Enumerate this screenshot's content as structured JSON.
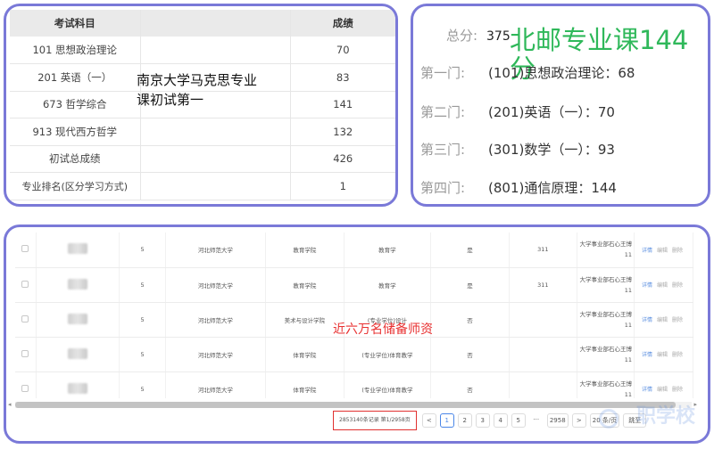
{
  "scores": {
    "header": {
      "subject": "考试科目",
      "score": "成绩"
    },
    "rows": [
      {
        "subject": "101 思想政治理论",
        "score": "70"
      },
      {
        "subject": "201 英语（一）",
        "score": "83"
      },
      {
        "subject": "673 哲学综合",
        "score": "141"
      },
      {
        "subject": "913 现代西方哲学",
        "score": "132"
      },
      {
        "subject": "初试总成绩",
        "score": "426"
      },
      {
        "subject": "专业排名(区分学习方式)",
        "score": "1"
      }
    ],
    "overlay_line1": "南京大学马克思专业",
    "overlay_line2": "课初试第一"
  },
  "bupt": {
    "total_label": "总分:",
    "total_value": "375",
    "headline_line1": "北邮专业课144",
    "headline_line2": "分",
    "items": [
      {
        "label": "第一门:",
        "value": "(101)思想政治理论：68"
      },
      {
        "label": "第二门:",
        "value": "(201)英语（一）：70"
      },
      {
        "label": "第三门:",
        "value": "(301)数学（一）：93"
      },
      {
        "label": "第四门:",
        "value": "(801)通信原理：144"
      }
    ]
  },
  "grid": {
    "rows": [
      {
        "num": "5",
        "school": "河北师范大学",
        "college": "教育学院",
        "major": "教育学",
        "flag": "是",
        "code": "311",
        "employer": "大学事业部石心王博11"
      },
      {
        "num": "5",
        "school": "河北师范大学",
        "college": "教育学院",
        "major": "教育学",
        "flag": "是",
        "code": "311",
        "employer": "大学事业部石心王博11"
      },
      {
        "num": "5",
        "school": "河北师范大学",
        "college": "美术与设计学院",
        "major": "(专业学位)设计",
        "flag": "否",
        "code": "",
        "employer": "大学事业部石心王博11"
      },
      {
        "num": "5",
        "school": "河北师范大学",
        "college": "体育学院",
        "major": "(专业学位)体育教学",
        "flag": "否",
        "code": "",
        "employer": "大学事业部石心王博11"
      },
      {
        "num": "5",
        "school": "河北师范大学",
        "college": "体育学院",
        "major": "(专业学位)体育教学",
        "flag": "否",
        "code": "",
        "employer": "大学事业部石心王博11"
      }
    ],
    "actions": {
      "detail": "详情",
      "edit": "编辑",
      "delete": "删除"
    },
    "overlay": "近六万名储备师资"
  },
  "pager": {
    "total": "2853140条记录 第1/2958页",
    "prev": "<",
    "pages": [
      "1",
      "2",
      "3",
      "4",
      "5"
    ],
    "ellipsis": "···",
    "last": "2958",
    "next": ">",
    "page_size": "20 条/页",
    "jump": "跳至"
  },
  "watermark": "职学校"
}
